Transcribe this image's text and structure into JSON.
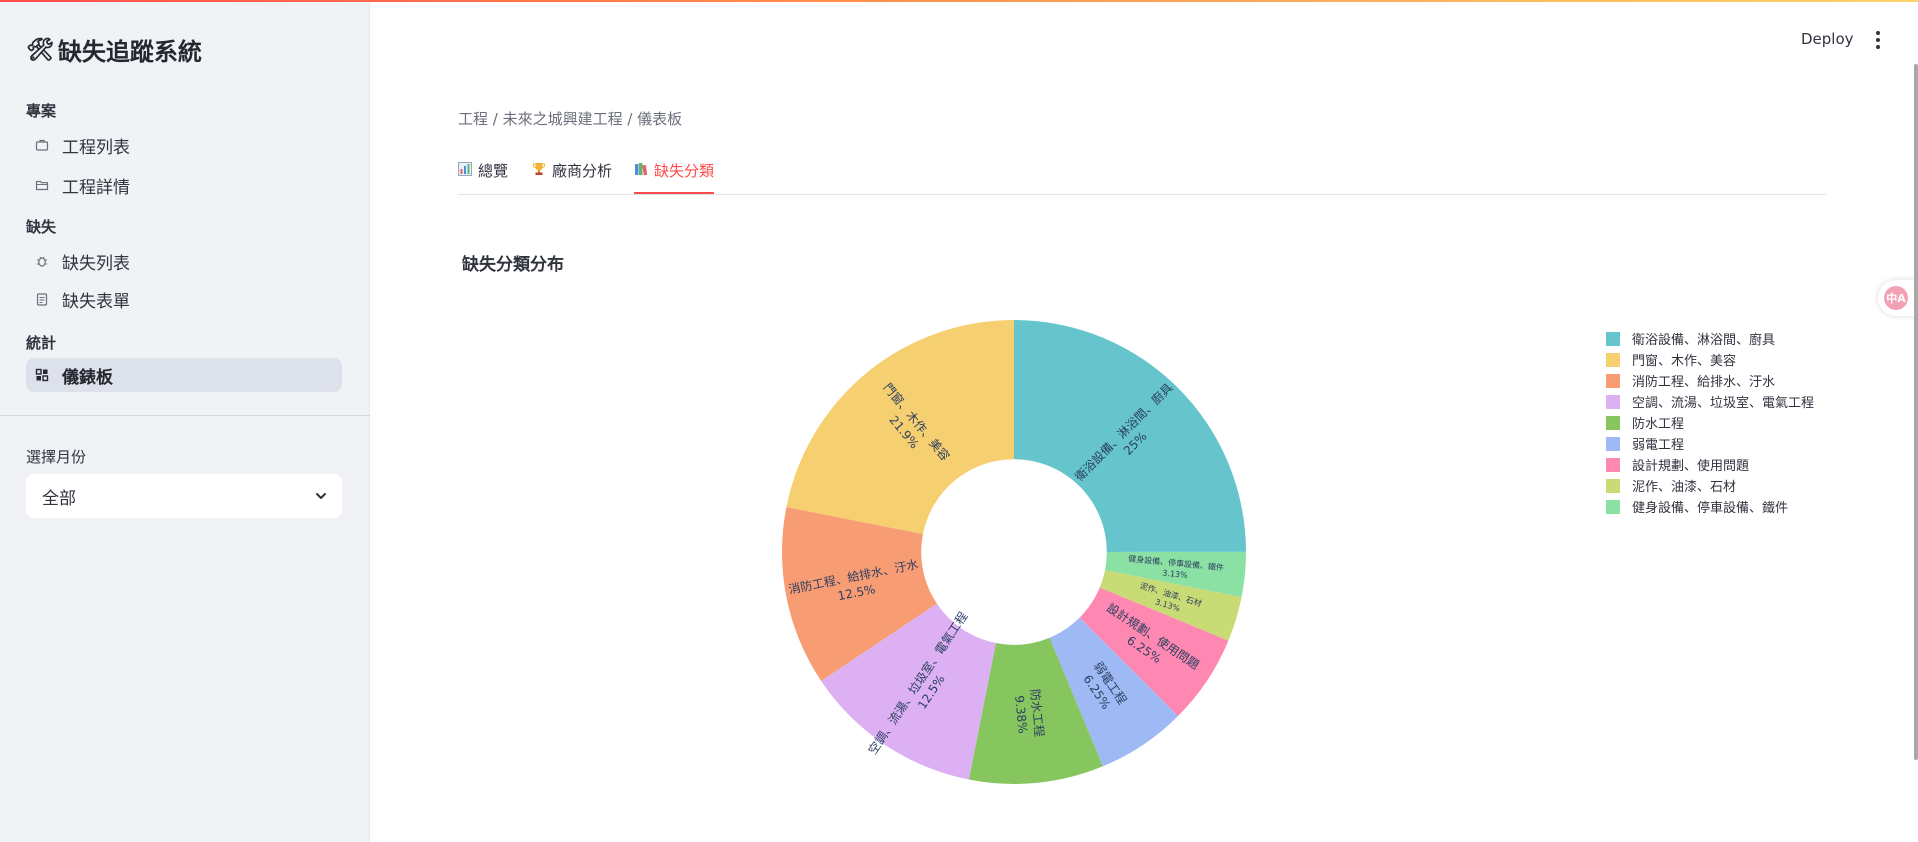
{
  "app": {
    "title": "缺失追蹤系統",
    "title_icon": "hammer-wrench-icon"
  },
  "sidebar": {
    "sections": [
      {
        "label": "專案",
        "items": [
          {
            "label": "工程列表",
            "icon": "briefcase-icon"
          },
          {
            "label": "工程詳情",
            "icon": "folder-open-icon"
          }
        ]
      },
      {
        "label": "缺失",
        "items": [
          {
            "label": "缺失列表",
            "icon": "bug-icon"
          },
          {
            "label": "缺失表單",
            "icon": "clipboard-icon"
          }
        ]
      },
      {
        "label": "統計",
        "items": [
          {
            "label": "儀錶板",
            "icon": "dashboard-icon",
            "active": true
          }
        ]
      }
    ],
    "month_filter": {
      "label": "選擇月份",
      "value": "全部"
    }
  },
  "header": {
    "deploy_label": "Deploy"
  },
  "main": {
    "breadcrumb": "工程 / 未來之城興建工程 / 儀表板",
    "tabs": [
      {
        "label": "總覽",
        "icon": "bar-chart-icon"
      },
      {
        "label": "廠商分析",
        "icon": "trophy-icon"
      },
      {
        "label": "缺失分類",
        "icon": "books-icon",
        "active": true
      }
    ],
    "chart_title": "缺失分類分布"
  },
  "chart_data": {
    "type": "pie",
    "hole": 0.4,
    "direction": "clockwise",
    "start": "top",
    "slices": [
      {
        "label": "衛浴設備、淋浴間、廚具",
        "value": 25,
        "text": "25%",
        "color": "#66c5cc"
      },
      {
        "label": "健身設備、停車設備、鐵件",
        "value": 3.13,
        "text": "3.13%",
        "color": "#8be0a4"
      },
      {
        "label": "泥作、油漆、石材",
        "value": 3.13,
        "text": "3.13%",
        "color": "#c9db74"
      },
      {
        "label": "設計規劃、使用問題",
        "value": 6.25,
        "text": "6.25%",
        "color": "#fe88b1"
      },
      {
        "label": "弱電工程",
        "value": 6.25,
        "text": "6.25%",
        "color": "#9eb9f3"
      },
      {
        "label": "防水工程",
        "value": 9.38,
        "text": "9.38%",
        "color": "#87c55f"
      },
      {
        "label": "空調、流湯、垃圾室、電氣工程",
        "value": 12.5,
        "text": "12.5%",
        "color": "#dcb0f2"
      },
      {
        "label": "消防工程、給排水、汙水",
        "value": 12.5,
        "text": "12.5%",
        "color": "#f89c74"
      },
      {
        "label": "門窗、木作、美容",
        "value": 21.9,
        "text": "21.9%",
        "color": "#f6cf71"
      }
    ],
    "legend": [
      "衛浴設備、淋浴間、廚具",
      "門窗、木作、美容",
      "消防工程、給排水、汙水",
      "空調、流湯、垃圾室、電氣工程",
      "防水工程",
      "弱電工程",
      "設計規劃、使用問題",
      "泥作、油漆、石材",
      "健身設備、停車設備、鐵件"
    ],
    "legend_colors": [
      "#66c5cc",
      "#f6cf71",
      "#f89c74",
      "#dcb0f2",
      "#87c55f",
      "#9eb9f3",
      "#fe88b1",
      "#c9db74",
      "#8be0a4"
    ],
    "legend_position": "right"
  }
}
